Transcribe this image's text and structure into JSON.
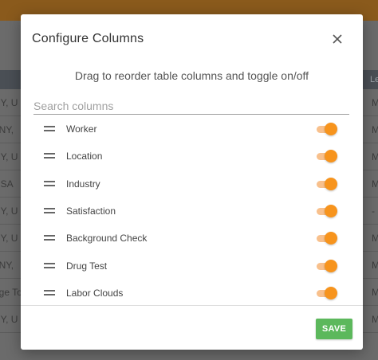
{
  "background": {
    "header_left": "",
    "header_right": "Le",
    "rows": [
      {
        "left": "NY, U",
        "right": "M"
      },
      {
        "left": ", NY, ",
        "right": "M"
      },
      {
        "left": "NY, U",
        "right": "M"
      },
      {
        "left": "USA",
        "right": "M"
      },
      {
        "left": "NY, U",
        "right": "-"
      },
      {
        "left": "NY, U",
        "right": "M"
      },
      {
        "left": ", NY, ",
        "right": "M"
      },
      {
        "left": "dge To",
        "right": "M"
      },
      {
        "left": "NY, U",
        "right": "M"
      }
    ]
  },
  "modal": {
    "title": "Configure Columns",
    "subtitle": "Drag to reorder table columns and toggle on/off",
    "search_placeholder": "Search columns",
    "search_value": "",
    "columns": [
      {
        "label": "Worker",
        "enabled": true
      },
      {
        "label": "Location",
        "enabled": true
      },
      {
        "label": "Industry",
        "enabled": true
      },
      {
        "label": "Satisfaction",
        "enabled": true
      },
      {
        "label": "Background Check",
        "enabled": true
      },
      {
        "label": "Drug Test",
        "enabled": true
      },
      {
        "label": "Labor Clouds",
        "enabled": true
      }
    ],
    "save_label": "SAVE"
  },
  "colors": {
    "accent": "#f7941d",
    "toggle_track": "#f8c08c",
    "save": "#5cb85c",
    "topbar": "#8a5a1c"
  },
  "icons": {
    "close": "close-icon",
    "drag": "drag-handle-icon"
  }
}
